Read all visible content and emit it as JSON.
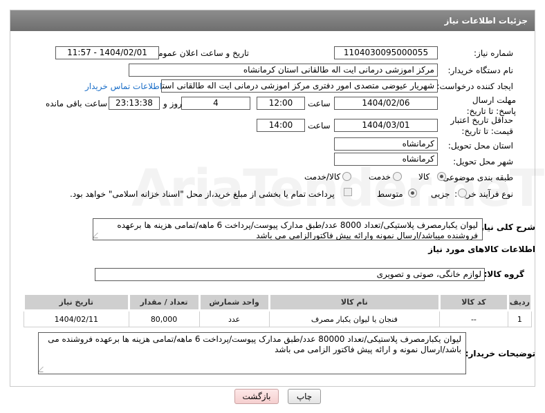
{
  "header": {
    "title": "جزئیات اطلاعات نیاز"
  },
  "fields": {
    "need_number_label": "شماره نیاز:",
    "need_number": "1104030095000055",
    "announce_label": "تاریخ و ساعت اعلان عمومی:",
    "announce_value": "1404/02/01 - 11:57",
    "buyer_label": "نام دستگاه خریدار:",
    "buyer_value": "مرکز اموزشی درمانی ایت اله طالقانی استان کرمانشاه",
    "creator_label": "ایجاد کننده درخواست:",
    "creator_value": "شهریار عیوضی متصدی امور دفتری مرکز اموزشی درمانی ایت اله طالقانی استان",
    "contact_link": "اطلاعات تماس خریدار",
    "reply_deadline_label": "مهلت ارسال پاسخ: تا تاریخ:",
    "reply_date": "1404/02/06",
    "time_label": "ساعت",
    "reply_time": "12:00",
    "days_count": "4",
    "days_label": "روز و",
    "remaining_time": "23:13:38",
    "remaining_label": "ساعت باقی مانده",
    "price_validity_label": "حداقل تاریخ اعتبار قیمت: تا تاریخ:",
    "price_date": "1404/03/01",
    "price_time": "14:00",
    "province_label": "استان محل تحویل:",
    "province_value": "کرمانشاه",
    "city_label": "شهر محل تحویل:",
    "city_value": "کرمانشاه",
    "category_label": "طبقه بندی موضوعی:",
    "category_options": [
      "کالا",
      "خدمت",
      "کالا/خدمت"
    ],
    "category_selected": "کالا",
    "process_label": "نوع فرآیند خرید :",
    "process_options": [
      "جزیی",
      "متوسط"
    ],
    "process_selected": "متوسط",
    "payment_note": "پرداخت تمام یا بخشی از مبلغ خرید،از محل \"اسناد خزانه اسلامی\" خواهد بود."
  },
  "summary": {
    "label": "شرح کلی نیاز:",
    "text": "لیوان یکبارمصرف پلاستیکی/تعداد 8000 عدد/طبق مدارک پیوست/پرداخت 6 ماهه/تمامی هزینه ها برعهده فروشنده میباشد/ارسال نمونه وارائه پیش فاکتورالزامی می باشد"
  },
  "goods_section": {
    "title": "اطلاعات کالاهای مورد نیاز",
    "group_label": "گروه کالا:",
    "group_value": "لوازم خانگی، صوتی و تصویری"
  },
  "table": {
    "headers": [
      "ردیف",
      "کد کالا",
      "نام کالا",
      "واحد شمارش",
      "تعداد / مقدار",
      "تاریخ نیاز"
    ],
    "rows": [
      [
        "1",
        "--",
        "فنجان یا لیوان یکبار مصرف",
        "عدد",
        "80,000",
        "1404/02/11"
      ]
    ]
  },
  "buyer_notes": {
    "label": "توضیحات خریدار:",
    "text": "لیوان یکبارمصرف پلاستیکی/تعداد 80000 عدد/طبق مدارک پیوست/پرداخت 6 ماهه/تمامی هزینه ها برعهده فروشنده می باشد/ارسال نمونه و ارائه پیش فاکتور الزامی می باشد"
  },
  "buttons": {
    "print": "چاپ",
    "back": "بازگشت"
  },
  "watermark": "AriaTender.neT"
}
